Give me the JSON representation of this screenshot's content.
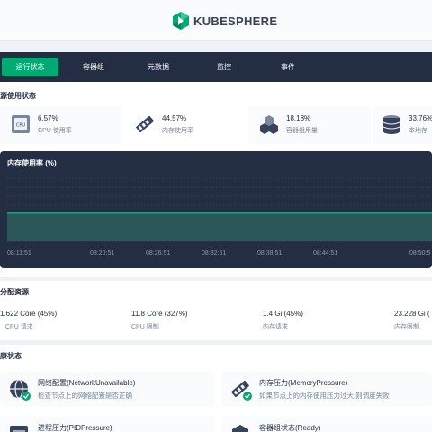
{
  "brand": {
    "name": "KUBESPHERE",
    "color": "#00aa72"
  },
  "tabs": [
    {
      "label": "运行状态",
      "active": true
    },
    {
      "label": "容器组",
      "active": false
    },
    {
      "label": "元数据",
      "active": false
    },
    {
      "label": "监控",
      "active": false
    },
    {
      "label": "事件",
      "active": false
    }
  ],
  "resource_usage": {
    "title": "源使用状态",
    "stats": [
      {
        "value": "6.57%",
        "label": "CPU 使用率",
        "icon": "cpu-icon"
      },
      {
        "value": "44.57%",
        "label": "内存使用率",
        "icon": "memory-icon"
      },
      {
        "value": "18.18%",
        "label": "容器组用量",
        "icon": "pods-icon"
      },
      {
        "value": "33.76%",
        "label": "本地存",
        "icon": "storage-icon"
      }
    ]
  },
  "chart_data": {
    "type": "area",
    "title": "内存使用率 (%)",
    "x": [
      "08:11:51",
      "08:20:51",
      "08:26:51",
      "08:32:51",
      "08:38:51",
      "08:44:51",
      "08:50:5"
    ],
    "series": [
      {
        "values": [
          44.57,
          44.57,
          44.57,
          44.57,
          44.57,
          44.57,
          44.57
        ]
      }
    ],
    "ylim": [
      0,
      100
    ],
    "grid": true,
    "colors": {
      "line": "#2ab598",
      "fill": "#2c5f5c"
    }
  },
  "allocation": {
    "title": "分配资源",
    "items": [
      {
        "value": "1.622 Core (45%)",
        "label": "CPU 请求"
      },
      {
        "value": "11.8 Core (327%)",
        "label": "CPU 限制"
      },
      {
        "value": "1.4 Gi (45%)",
        "label": "内存请求"
      },
      {
        "value": "23.228 Gi (",
        "label": "内存限制"
      }
    ]
  },
  "health": {
    "title": "康状态",
    "cards": [
      {
        "title": "网络配置(NetworkUnavailable)",
        "desc": "检查节点上的网络配置是否正确",
        "icon": "network-icon"
      },
      {
        "title": "内存压力(MemoryPressure)",
        "desc": "如果节点上的内存使用压力过大,则调度失败",
        "icon": "memory-icon"
      },
      {
        "title": "进程压力(PIDPressure)",
        "desc": "",
        "icon": "process-icon"
      },
      {
        "title": "容器组状态(Ready)",
        "desc": "",
        "icon": "ready-icon"
      }
    ]
  }
}
